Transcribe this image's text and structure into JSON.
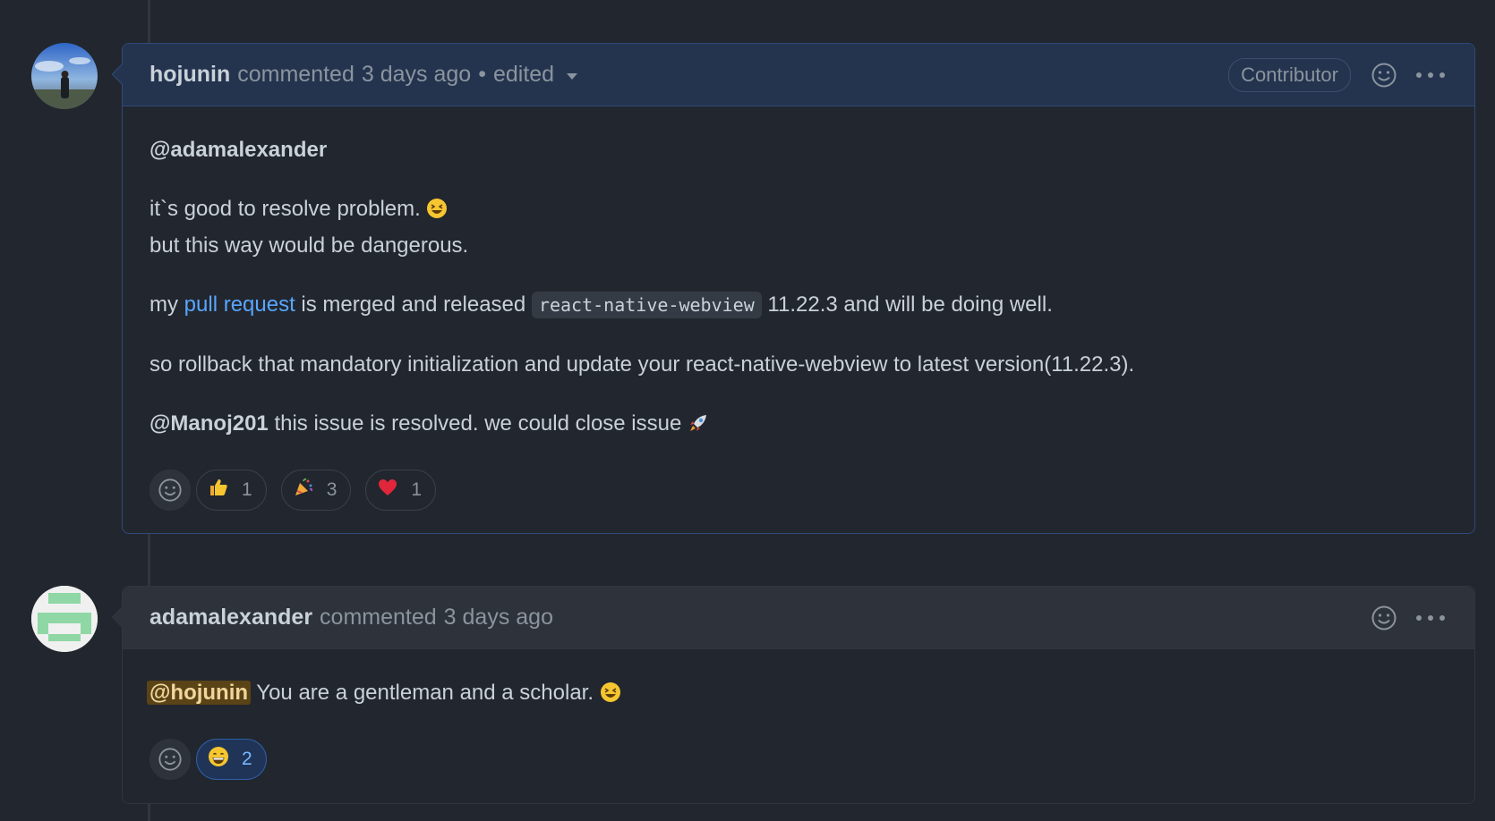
{
  "comments": [
    {
      "author": "hojunin",
      "action": "commented",
      "time": "3 days ago",
      "separator": "•",
      "edited": "edited",
      "badge": "Contributor",
      "body": {
        "mention": "@adamalexander",
        "line1": "it`s good to resolve problem.",
        "line2": "but this way would be dangerous.",
        "p3_pre": "my",
        "p3_link": "pull request",
        "p3_mid": "is merged and released",
        "p3_code": "react-native-webview",
        "p3_post": "11.22.3 and will be doing well.",
        "p4": "so rollback that mandatory initialization and update your react-native-webview to latest version(11.22.3).",
        "p5_mention": "@Manoj201",
        "p5_text": "this issue is resolved. we could close issue"
      },
      "reactions": [
        {
          "emoji": "thumbs-up",
          "count": "1"
        },
        {
          "emoji": "party-popper",
          "count": "3"
        },
        {
          "emoji": "heart",
          "count": "1"
        }
      ]
    },
    {
      "author": "adamalexander",
      "action": "commented",
      "time": "3 days ago",
      "body": {
        "mention": "@hojunin",
        "text": "You are a gentleman and a scholar."
      },
      "reactions": [
        {
          "emoji": "grinning-face",
          "count": "2",
          "active": true
        }
      ]
    }
  ],
  "colors": {
    "background": "#22262e",
    "header_highlight": "#24344f",
    "link": "#58a6ff",
    "mention_highlight": "#5a4417"
  }
}
